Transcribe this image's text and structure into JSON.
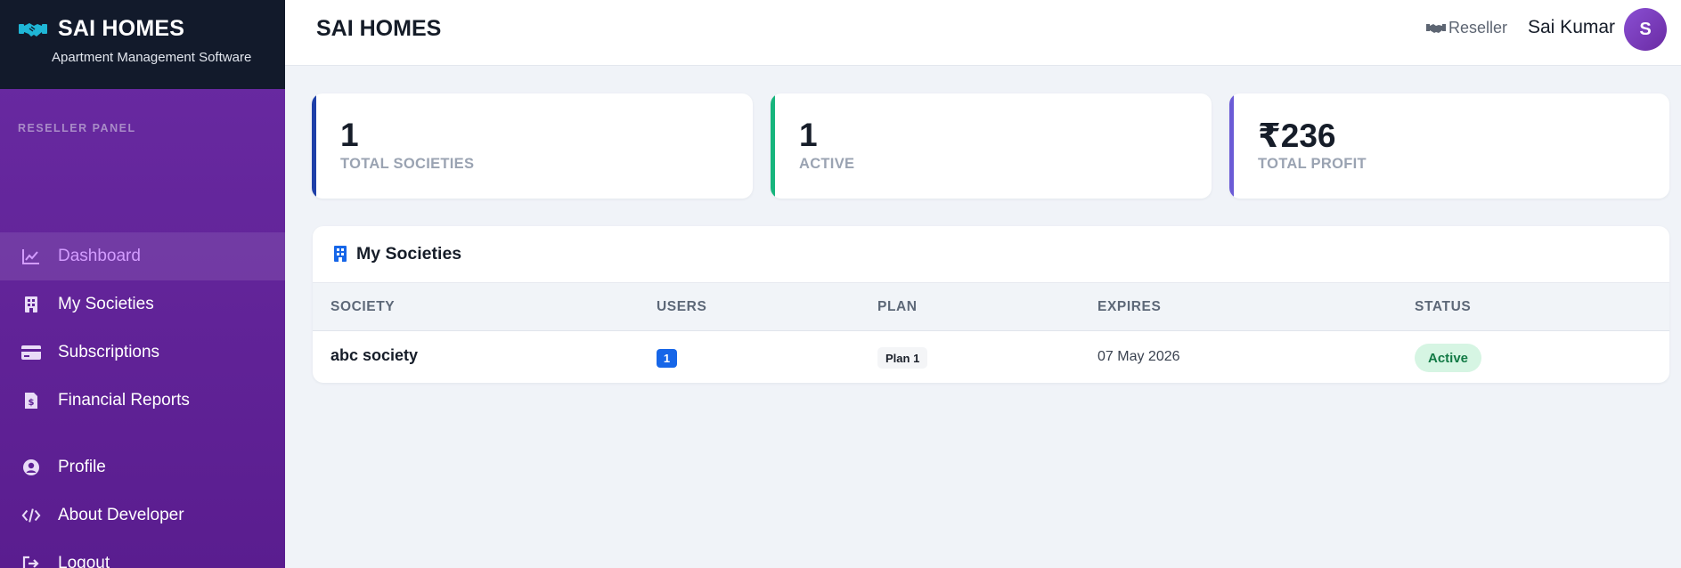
{
  "brand": {
    "title": "SAI HOMES",
    "subtitle": "Apartment Management Software",
    "icon": "handshake-icon"
  },
  "sidebar": {
    "section_label": "RESELLER PANEL",
    "items": [
      {
        "label": "Dashboard",
        "icon": "chart-line-icon",
        "active": true
      },
      {
        "label": "My Societies",
        "icon": "building-icon",
        "active": false
      },
      {
        "label": "Subscriptions",
        "icon": "credit-card-icon",
        "active": false
      },
      {
        "label": "Financial Reports",
        "icon": "invoice-dollar-icon",
        "active": false
      },
      {
        "label": "Profile",
        "icon": "user-circle-icon",
        "active": false
      },
      {
        "label": "About Developer",
        "icon": "code-icon",
        "active": false
      },
      {
        "label": "Logout",
        "icon": "logout-icon",
        "active": false
      }
    ]
  },
  "header": {
    "title": "SAI HOMES",
    "role_label": "Reseller",
    "user_name": "Sai Kumar",
    "avatar_initial": "S"
  },
  "stats": [
    {
      "value": "1",
      "label": "TOTAL SOCIETIES",
      "accent": "#1e3fa8"
    },
    {
      "value": "1",
      "label": "ACTIVE",
      "accent": "#17b57d"
    },
    {
      "value": "₹236",
      "label": "TOTAL PROFIT",
      "accent": "#6b5bd6"
    }
  ],
  "societies_table": {
    "title": "My Societies",
    "columns": [
      "SOCIETY",
      "USERS",
      "PLAN",
      "EXPIRES",
      "STATUS"
    ],
    "rows": [
      {
        "society": "abc society",
        "users": "1",
        "plan": "Plan 1",
        "expires": "07 May 2026",
        "status": "Active"
      }
    ]
  },
  "colors": {
    "sidebar_bg": "#5e2196",
    "brand_bg": "#121a2b",
    "active_nav_text": "#d39cff",
    "primary_blue": "#1666e8",
    "success_green": "#17b57d"
  }
}
